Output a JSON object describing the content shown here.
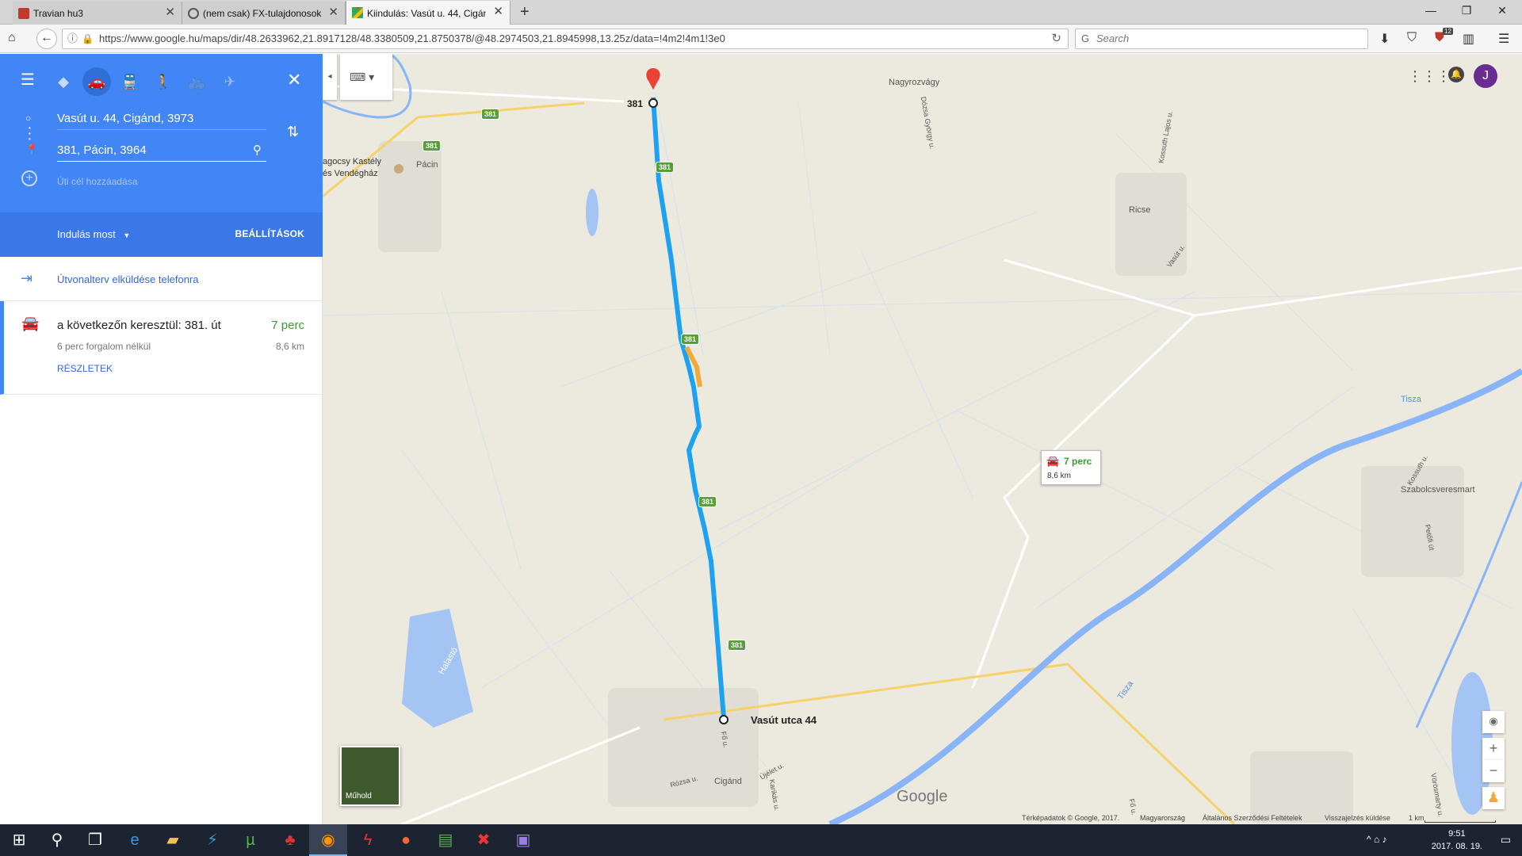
{
  "browser": {
    "tabs": [
      {
        "label": "Travian hu3",
        "favicon_color": "#c0392b"
      },
      {
        "label": "(nem csak) FX-tulajdonosok",
        "favicon_color": "#555555"
      },
      {
        "label": "Kiindulás: Vasút u. 44, Cigánd",
        "favicon_color": "#34a853"
      }
    ],
    "new_tab": "+",
    "url": "https://www.google.hu/maps/dir/48.2633962,21.8917128/48.3380509,21.8750378/@48.2974503,21.8945998,13.25z/data=!4m2!4m1!3e0",
    "search_placeholder": "Search",
    "badge_count": "12"
  },
  "panel": {
    "origin": "Vasút u. 44, Cigánd, 3973",
    "destination": "381, Pácin, 3964",
    "add_destination": "Úti cél hozzáadása",
    "departure": "Indulás most",
    "settings": "BEÁLLÍTÁSOK",
    "send_to_phone": "Útvonalterv elküldése telefonra",
    "route": {
      "via": "a következőn keresztül: 381. út",
      "time": "7 perc",
      "no_traffic": "6 perc forgalom nélkül",
      "distance": "8,6 km",
      "details": "RÉSZLETEK"
    }
  },
  "map": {
    "places": {
      "nagyrozvagy": "Nagyrozvágy",
      "pacin": "Pácin",
      "kastely_1": "agocsy Kastély",
      "kastely_2": "és Vendégház",
      "ricse": "Ricse",
      "szabolcsveresmart": "Szabolcsveresmart",
      "cigand": "Cigánd",
      "tisza_1": "Tisza",
      "tisza_2": "Tisza",
      "halasto": "Halastó",
      "dozsa": "Dózsa György u.",
      "kossuth_1": "Kossuth Lajos u.",
      "kossuth_2": "Kossuth u.",
      "vasut_u": "Vasút u.",
      "petofi": "Petőfi út",
      "rozsa": "Rózsa u.",
      "ujelet": "Újélet u.",
      "karikas": "Karikás u.",
      "fo_u_1": "Fő u.",
      "fo_u_2": "Fő u.",
      "vorosmarty": "Vörösmarty u."
    },
    "road_number": "381",
    "start_label": "381",
    "end_label": "Vasút utca 44",
    "popup_time": "7 perc",
    "popup_distance": "8,6 km",
    "satellite_label": "Műhold",
    "google": "Google",
    "footer": {
      "copyright": "Térképadatok © Google, 2017.",
      "country": "Magyarország",
      "terms": "Általános Szerződési Feltételek",
      "feedback": "Visszajelzés küldése",
      "scale": "1 km"
    },
    "avatar_letter": "J",
    "zoom_in": "+",
    "zoom_out": "−"
  },
  "taskbar": {
    "time": "9:51",
    "date": "2017. 08. 19."
  },
  "colors": {
    "route": "#1da1f2",
    "route_congested": "#f2a93b",
    "panel_blue": "#4285f4",
    "travel_time_green": "#3c9a32"
  }
}
